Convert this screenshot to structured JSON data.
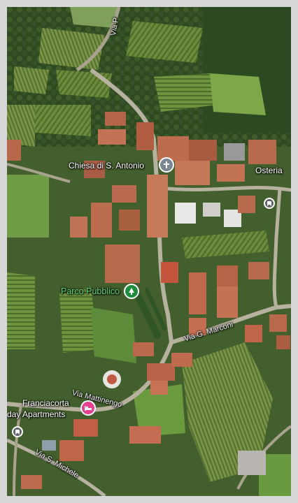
{
  "map": {
    "type": "satellite",
    "places": {
      "church": "Chiesa di S. Antonio",
      "osteria": "Osteria",
      "park": "Parco Pubblico",
      "apartments_line1": "Franciacorta",
      "apartments_line2": "day Apartments"
    },
    "roads": {
      "via_p": "Via P",
      "via_marconi": "Via G. Marconi",
      "via_mattinengo": "Via Mattinengo",
      "via_michele": "Via S. Michele"
    },
    "icons": {
      "church": "church-cross-icon",
      "park": "park-tree-icon",
      "hotel": "hotel-bed-icon",
      "bus": "bus-stop-icon"
    },
    "colors": {
      "label_white": "#ffffff",
      "park_label": "#63d47a",
      "church_pin": "#7a8691",
      "park_pin": "#1e8e3e",
      "hotel_pin": "#e8418f",
      "bus_pin": "#5f6368"
    }
  }
}
